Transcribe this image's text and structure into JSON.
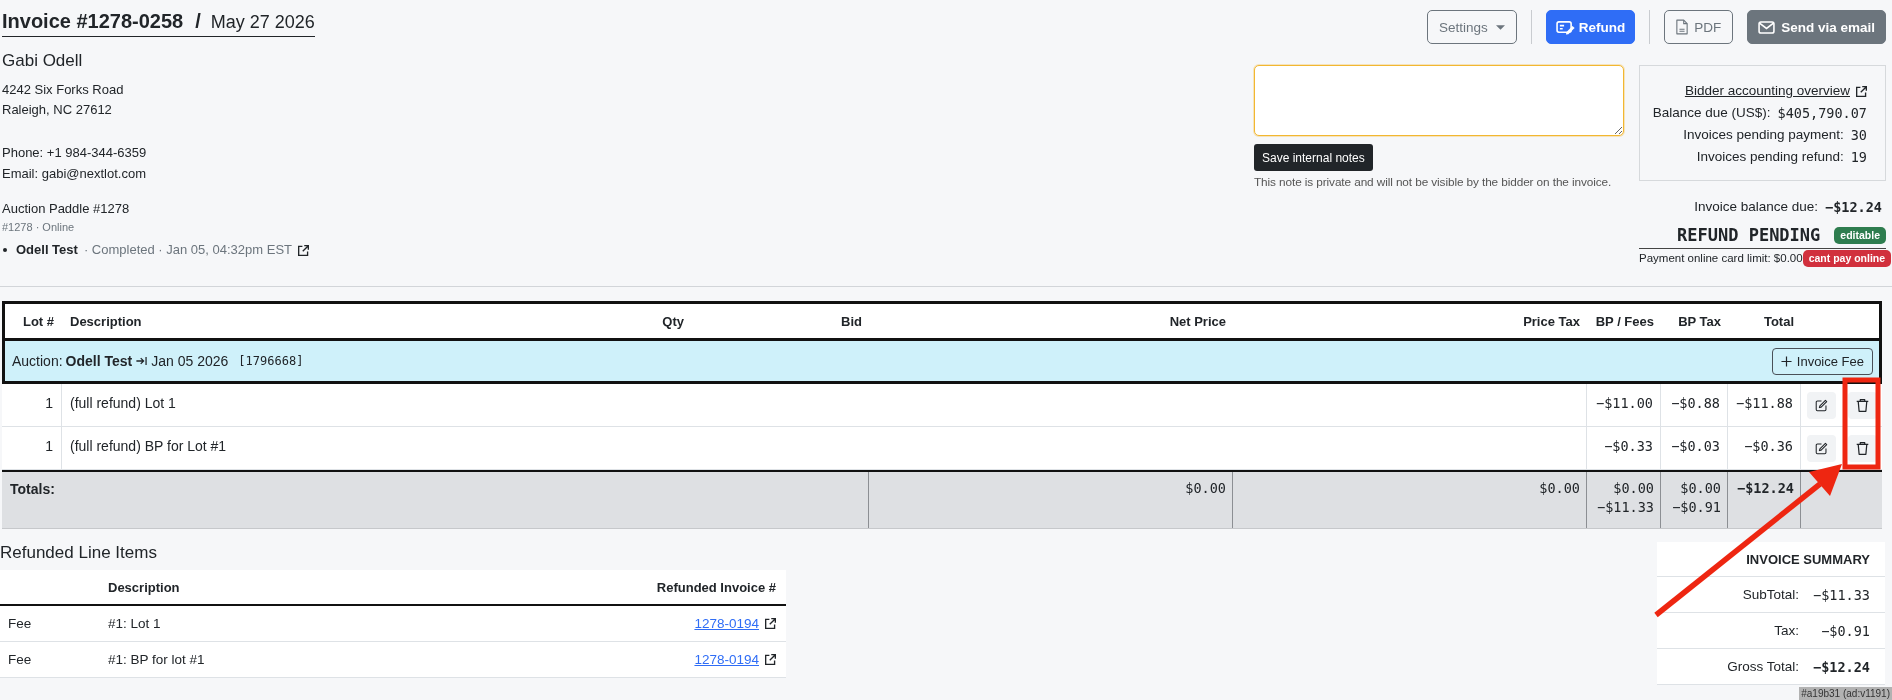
{
  "header": {
    "title": "Invoice #1278-0258",
    "separator": "/",
    "date": "May 27 2026"
  },
  "bidder": {
    "name": "Gabi Odell",
    "address_lines": [
      "4242 Six Forks Road",
      "Raleigh, NC 27612"
    ],
    "contact_lines": [
      "Phone: +1 984-344-6359",
      "Email: gabi@nextlot.com"
    ],
    "paddle": "Auction Paddle #1278",
    "paddle_detail": "#1278 · Online",
    "auctions": [
      {
        "name": "Odell Test",
        "detail": "· Completed · Jan 05, 04:32pm EST"
      }
    ]
  },
  "toolbar": [
    {
      "kind": "dropdown",
      "label": "Settings"
    },
    {
      "kind": "divider"
    },
    {
      "kind": "primary",
      "label": "Refund"
    },
    {
      "kind": "divider"
    },
    {
      "kind": "outline",
      "label": "PDF"
    },
    {
      "kind": "secondary",
      "label": "Send via email"
    }
  ],
  "notes": {
    "focused": true,
    "save_label": "Save internal notes",
    "hint": "This note is private and will not be visible by the bidder on the invoice."
  },
  "account": {
    "link": "Bidder accounting overview",
    "rows": [
      {
        "label": "Balance due (US$):",
        "value": "$405,790.07"
      },
      {
        "label": "Invoices pending payment:",
        "value": "30"
      },
      {
        "label": "Invoices pending refund:",
        "value": "19"
      }
    ]
  },
  "status": {
    "balance_label": "Invoice balance due:",
    "balance_value": "−$12.24",
    "state": "REFUND PENDING",
    "state_badge": "editable",
    "card_limit": "Payment online card limit: $0.00",
    "card_badge": "cant pay online"
  },
  "line_items": {
    "columns": [
      "Lot #",
      "Description",
      "Qty",
      "Bid",
      "Net Price",
      "Price Tax",
      "BP / Fees",
      "BP Tax",
      "Total"
    ],
    "auction_group": {
      "label": "Auction:",
      "name": "Odell Test",
      "date": "Jan 05 2026",
      "reference": "[1796668]",
      "fee_button": "Invoice Fee"
    },
    "rows": [
      {
        "lot": "1",
        "description": "(full refund) Lot 1",
        "bp_fees": "−$11.00",
        "bp_tax": "−$0.88",
        "total": "−$11.88"
      },
      {
        "lot": "1",
        "description": "(full refund) BP for Lot #1",
        "bp_fees": "−$0.33",
        "bp_tax": "−$0.03",
        "total": "−$0.36"
      }
    ],
    "totals": {
      "label": "Totals:",
      "net_price": [
        "$0.00"
      ],
      "price_tax": [
        "$0.00"
      ],
      "bp_fees": [
        "$0.00",
        "−$11.33"
      ],
      "bp_tax": [
        "$0.00",
        "−$0.91"
      ],
      "total": [
        "−$12.24"
      ]
    }
  },
  "refunded_line_items": {
    "title": "Refunded Line Items",
    "columns": [
      "Description",
      "Refunded Invoice #"
    ],
    "rows": [
      {
        "column_1": "Fee",
        "description": "#1: Lot 1",
        "refunded_invoice": "1278-0194"
      },
      {
        "column_1": "Fee",
        "description": "#1: BP for lot #1",
        "refunded_invoice": "1278-0194"
      }
    ]
  },
  "invoice_summary": {
    "title": "INVOICE SUMMARY",
    "rows": [
      {
        "kind": "line",
        "label": "SubTotal:",
        "value": "−$11.33"
      },
      {
        "kind": "line",
        "label": "Tax:",
        "value": "−$0.91"
      },
      {
        "kind": "total",
        "label": "Gross Total:",
        "value": "−$12.24"
      }
    ]
  },
  "annotation": {
    "kind": "box-and-arrow"
  },
  "version_tag": "#a19b31 (ad:v1191)"
}
